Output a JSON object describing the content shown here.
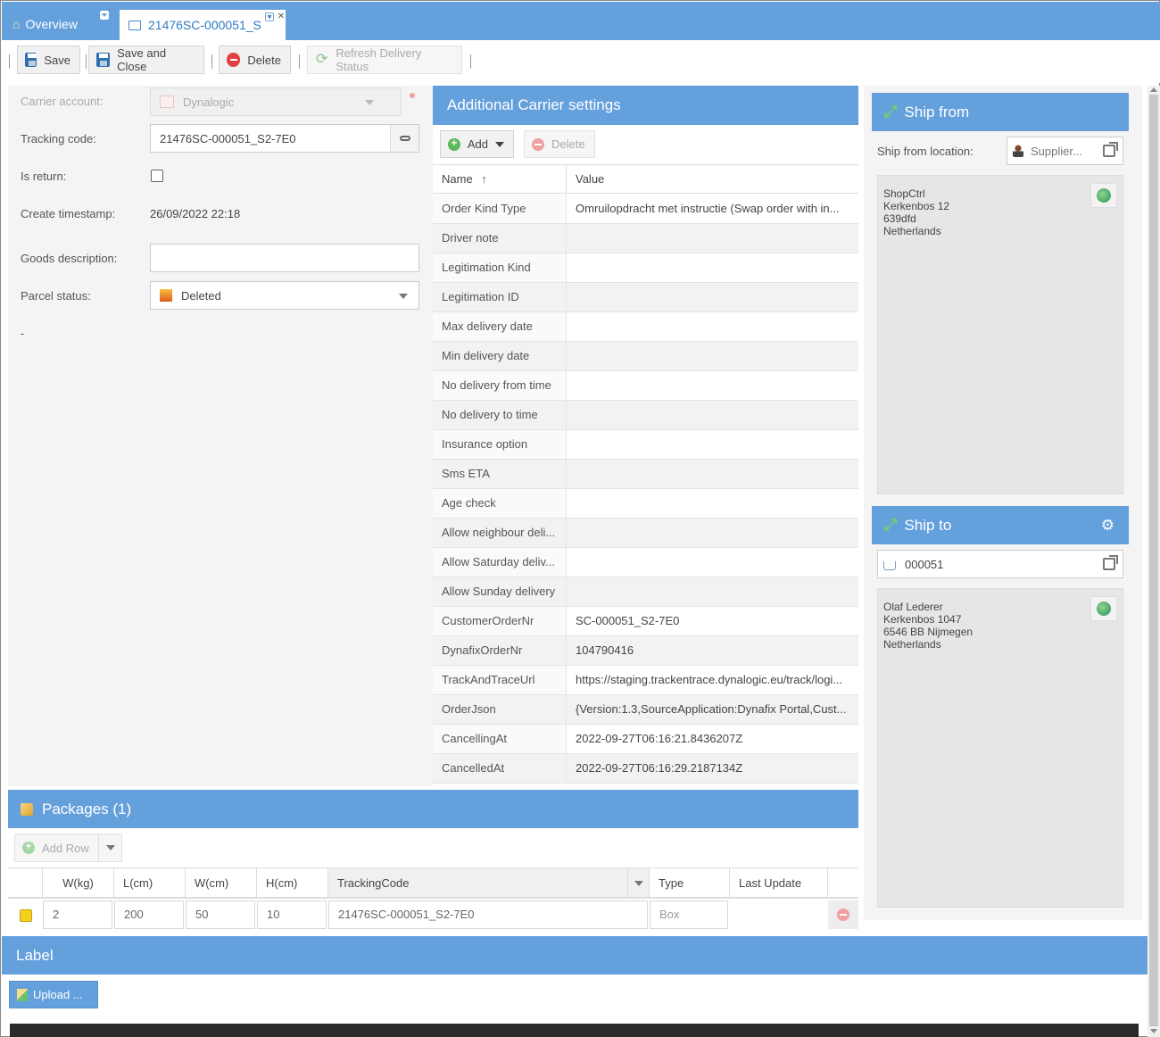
{
  "tabs": {
    "overview": "Overview",
    "document": "21476SC-000051_S"
  },
  "toolbar": {
    "save": "Save",
    "save_close": "Save and Close",
    "delete": "Delete",
    "refresh": "Refresh Delivery Status"
  },
  "form": {
    "carrier_label": "Carrier account:",
    "carrier_value": "Dynalogic",
    "tracking_label": "Tracking code:",
    "tracking_value": "21476SC-000051_S2-7E0",
    "is_return_label": "Is return:",
    "created_label": "Create timestamp:",
    "created_value": "26/09/2022 22:18",
    "goods_label": "Goods description:",
    "goods_value": "",
    "status_label": "Parcel status:",
    "status_value": "Deleted",
    "dash": "-"
  },
  "carrier_settings": {
    "title": "Additional Carrier settings",
    "add": "Add",
    "delete": "Delete",
    "col_name": "Name",
    "col_value": "Value",
    "rows": [
      {
        "name": "Order Kind Type",
        "value": "Omruilopdracht met instructie (Swap order with in..."
      },
      {
        "name": "Driver note",
        "value": ""
      },
      {
        "name": "Legitimation Kind",
        "value": ""
      },
      {
        "name": "Legitimation ID",
        "value": ""
      },
      {
        "name": "Max delivery date",
        "value": ""
      },
      {
        "name": "Min delivery date",
        "value": ""
      },
      {
        "name": "No delivery from time",
        "value": ""
      },
      {
        "name": "No delivery to time",
        "value": ""
      },
      {
        "name": "Insurance option",
        "value": ""
      },
      {
        "name": "Sms ETA",
        "value": ""
      },
      {
        "name": "Age check",
        "value": ""
      },
      {
        "name": "Allow neighbour deli...",
        "value": ""
      },
      {
        "name": "Allow Saturday deliv...",
        "value": ""
      },
      {
        "name": "Allow Sunday delivery",
        "value": ""
      },
      {
        "name": "CustomerOrderNr",
        "value": "SC-000051_S2-7E0"
      },
      {
        "name": "DynafixOrderNr",
        "value": "104790416"
      },
      {
        "name": "TrackAndTraceUrl",
        "value": "https://staging.trackentrace.dynalogic.eu/track/logi..."
      },
      {
        "name": "OrderJson",
        "value": "{Version:1.3,SourceApplication:Dynafix Portal,Cust..."
      },
      {
        "name": "CancellingAt",
        "value": "2022-09-27T06:16:21.8436207Z"
      },
      {
        "name": "CancelledAt",
        "value": "2022-09-27T06:16:29.2187134Z"
      }
    ]
  },
  "ship_from": {
    "title": "Ship from",
    "location_label": "Ship from location:",
    "location_value": "Supplier...",
    "address": [
      "ShopCtrl",
      "Kerkenbos 12",
      "639dfd",
      "Netherlands"
    ]
  },
  "ship_to": {
    "title": "Ship to",
    "value": "000051",
    "address": [
      "Olaf Lederer",
      "Kerkenbos 1047",
      "6546 BB Nijmegen",
      "Netherlands"
    ]
  },
  "packages": {
    "title": "Packages (1)",
    "add_row": "Add Row",
    "columns": [
      "W(kg)",
      "L(cm)",
      "W(cm)",
      "H(cm)",
      "TrackingCode",
      "Type",
      "Last Update"
    ],
    "row": {
      "w": "2",
      "l": "200",
      "wc": "50",
      "h": "10",
      "tracking": "21476SC-000051_S2-7E0",
      "type": "Box",
      "last_update": ""
    }
  },
  "label": {
    "title": "Label",
    "upload": "Upload ..."
  },
  "colors": {
    "accent": "#64a0dc",
    "panel": "#f4f4f4"
  }
}
